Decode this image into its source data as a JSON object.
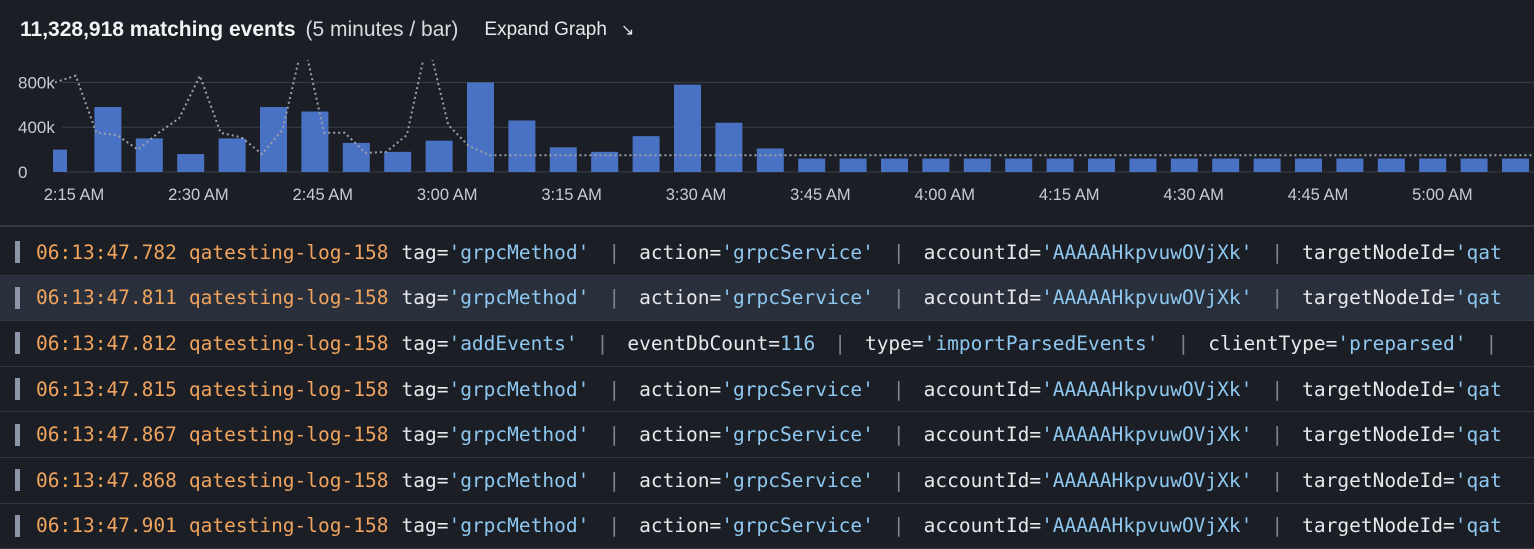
{
  "header": {
    "count_label": "11,328,918 matching events",
    "interval_label": "(5 minutes / bar)",
    "expand_label": "Expand Graph",
    "expand_icon": "↘"
  },
  "chart_data": {
    "type": "bar",
    "y_tick_labels": [
      "800k",
      "400k",
      "0"
    ],
    "y_ticks": [
      800000,
      400000,
      0
    ],
    "ylim": [
      0,
      1000000
    ],
    "x_tick_labels": [
      "2:15 AM",
      "2:30 AM",
      "2:45 AM",
      "3:00 AM",
      "3:15 AM",
      "3:30 AM",
      "3:45 AM",
      "4:00 AM",
      "4:15 AM",
      "4:30 AM",
      "4:45 AM",
      "5:00 AM"
    ],
    "bar_values": [
      200000,
      580000,
      300000,
      160000,
      300000,
      580000,
      540000,
      260000,
      180000,
      280000,
      800000,
      460000,
      220000,
      180000,
      320000,
      780000,
      440000,
      210000,
      120000,
      120000,
      120000,
      120000,
      120000,
      120000,
      120000,
      120000,
      120000,
      120000,
      120000,
      120000,
      120000,
      120000,
      120000,
      120000,
      120000,
      120000,
      120000
    ],
    "comparison_line_values": [
      800000,
      860000,
      350000,
      330000,
      200000,
      350000,
      480000,
      860000,
      350000,
      310000,
      160000,
      380000,
      1180000,
      350000,
      350000,
      170000,
      180000,
      330000,
      1180000,
      420000,
      230000,
      150000,
      150000,
      150000,
      150000,
      150000,
      150000,
      150000,
      150000,
      150000,
      150000,
      150000,
      150000,
      150000,
      150000,
      150000,
      150000,
      150000,
      150000,
      150000,
      150000,
      150000,
      150000,
      150000,
      150000,
      150000
    ],
    "grid": true,
    "colors": {
      "bar": "#4a72c4",
      "line": "#9aa0aa",
      "grid": "#3a3f48",
      "axis_text": "#c8ccd2"
    }
  },
  "log_rows": [
    {
      "timestamp": "06:13:47.782",
      "source": "qatesting-log-158",
      "selected": false,
      "fields": [
        {
          "k": "tag=",
          "v": "'grpcMethod'"
        },
        {
          "k": "action=",
          "v": "'grpcService'"
        },
        {
          "k": "accountId=",
          "v": "'AAAAAHkpvuwOVjXk'"
        },
        {
          "k": "targetNodeId=",
          "v": "'qat"
        }
      ]
    },
    {
      "timestamp": "06:13:47.811",
      "source": "qatesting-log-158",
      "selected": true,
      "fields": [
        {
          "k": "tag=",
          "v": "'grpcMethod'"
        },
        {
          "k": "action=",
          "v": "'grpcService'"
        },
        {
          "k": "accountId=",
          "v": "'AAAAAHkpvuwOVjXk'"
        },
        {
          "k": "targetNodeId=",
          "v": "'qat"
        }
      ]
    },
    {
      "timestamp": "06:13:47.812",
      "source": "qatesting-log-158",
      "selected": false,
      "fields": [
        {
          "k": "tag=",
          "v": "'addEvents'"
        },
        {
          "k": "eventDbCount=",
          "v": "116"
        },
        {
          "k": "type=",
          "v": "'importParsedEvents'"
        },
        {
          "k": "clientType=",
          "v": "'preparsed'"
        }
      ]
    },
    {
      "timestamp": "06:13:47.815",
      "source": "qatesting-log-158",
      "selected": false,
      "fields": [
        {
          "k": "tag=",
          "v": "'grpcMethod'"
        },
        {
          "k": "action=",
          "v": "'grpcService'"
        },
        {
          "k": "accountId=",
          "v": "'AAAAAHkpvuwOVjXk'"
        },
        {
          "k": "targetNodeId=",
          "v": "'qat"
        }
      ]
    },
    {
      "timestamp": "06:13:47.867",
      "source": "qatesting-log-158",
      "selected": false,
      "fields": [
        {
          "k": "tag=",
          "v": "'grpcMethod'"
        },
        {
          "k": "action=",
          "v": "'grpcService'"
        },
        {
          "k": "accountId=",
          "v": "'AAAAAHkpvuwOVjXk'"
        },
        {
          "k": "targetNodeId=",
          "v": "'qat"
        }
      ]
    },
    {
      "timestamp": "06:13:47.868",
      "source": "qatesting-log-158",
      "selected": false,
      "fields": [
        {
          "k": "tag=",
          "v": "'grpcMethod'"
        },
        {
          "k": "action=",
          "v": "'grpcService'"
        },
        {
          "k": "accountId=",
          "v": "'AAAAAHkpvuwOVjXk'"
        },
        {
          "k": "targetNodeId=",
          "v": "'qat"
        }
      ]
    },
    {
      "timestamp": "06:13:47.901",
      "source": "qatesting-log-158",
      "selected": false,
      "fields": [
        {
          "k": "tag=",
          "v": "'grpcMethod'"
        },
        {
          "k": "action=",
          "v": "'grpcService'"
        },
        {
          "k": "accountId=",
          "v": "'AAAAAHkpvuwOVjXk'"
        },
        {
          "k": "targetNodeId=",
          "v": "'qat"
        }
      ]
    }
  ]
}
